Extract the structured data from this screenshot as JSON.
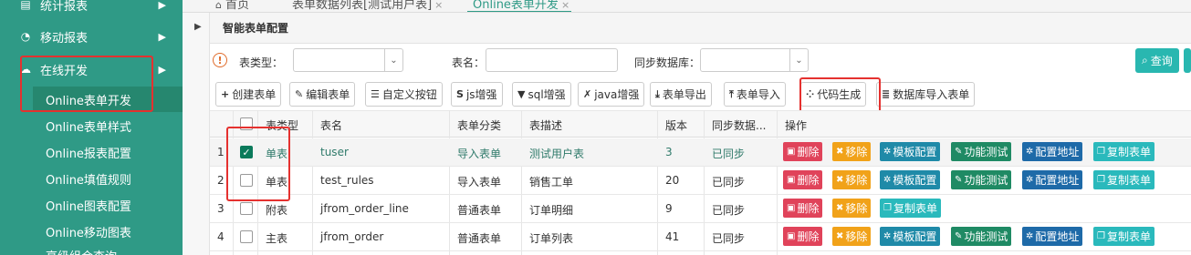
{
  "sidebar": {
    "top_item": "统计报表",
    "items": [
      {
        "label": "移动报表",
        "icon": "pie-chart-icon"
      },
      {
        "label": "在线开发",
        "icon": "cloud-icon"
      }
    ],
    "sub_items": [
      {
        "label": "Online表单开发"
      },
      {
        "label": "Online表单样式"
      },
      {
        "label": "Online报表配置"
      },
      {
        "label": "Online填值规则"
      },
      {
        "label": "Online图表配置"
      },
      {
        "label": "Online移动图表"
      },
      {
        "label": "高级组合查询"
      }
    ]
  },
  "tabs": [
    {
      "label": "首页"
    },
    {
      "label": "表单数据列表[测试用户表]",
      "close": "×"
    },
    {
      "label": "Online表单开发",
      "close": "×"
    }
  ],
  "panel": {
    "title": "智能表单配置"
  },
  "search": {
    "table_type_label": "表类型：",
    "table_name_label": "表名：",
    "sync_label": "同步数据库：",
    "query_label": "查询",
    "warn": "!"
  },
  "toolbar": {
    "create": "创建表单",
    "edit": "编辑表单",
    "custom_button": "自定义按钮",
    "js": "js增强",
    "sql": "sql增强",
    "java": "java增强",
    "export": "表单导出",
    "import": "表单导入",
    "codegen": "代码生成",
    "db_import": "数据库导入表单"
  },
  "table": {
    "headers": [
      "表类型",
      "表名",
      "表单分类",
      "表描述",
      "版本",
      "同步数据...",
      "操作"
    ],
    "rows": [
      {
        "no": "1",
        "checked": true,
        "type": "单表",
        "name": "tuser",
        "category": "导入表单",
        "desc": "测试用户表",
        "version": "3",
        "sync": "已同步",
        "ops": [
          "删除",
          "移除",
          "模板配置",
          "功能测试",
          "配置地址",
          "复制表单"
        ]
      },
      {
        "no": "2",
        "checked": false,
        "type": "单表",
        "name": "test_rules",
        "category": "导入表单",
        "desc": "销售工单",
        "version": "20",
        "sync": "已同步",
        "ops": [
          "删除",
          "移除",
          "模板配置",
          "功能测试",
          "配置地址",
          "复制表单"
        ]
      },
      {
        "no": "3",
        "checked": false,
        "type": "附表",
        "name": "jfrom_order_line",
        "category": "普通表单",
        "desc": "订单明细",
        "version": "9",
        "sync": "已同步",
        "ops": [
          "删除",
          "移除",
          "复制表单"
        ]
      },
      {
        "no": "4",
        "checked": false,
        "type": "主表",
        "name": "jfrom_order",
        "category": "普通表单",
        "desc": "订单列表",
        "version": "41",
        "sync": "已同步",
        "ops": [
          "删除",
          "移除",
          "模板配置",
          "功能测试",
          "配置地址",
          "复制表单"
        ]
      }
    ]
  },
  "colors": {
    "sidebar": "#2f9a86",
    "highlight_box": "#e5312f",
    "accent": "#29b7b0"
  }
}
